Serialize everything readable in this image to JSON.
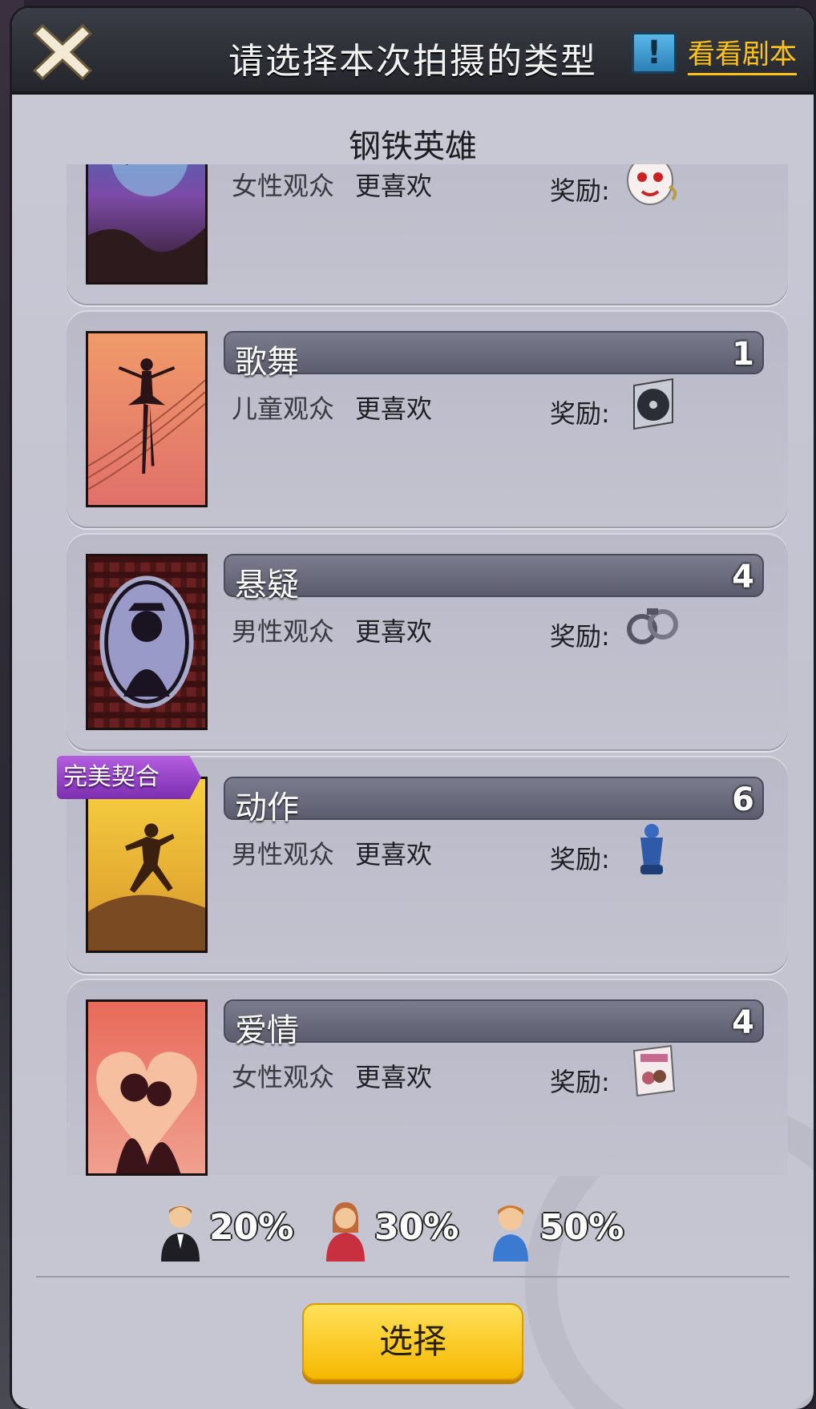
{
  "header": {
    "title": "请选择本次拍摄的类型",
    "script_label": "看看剧本",
    "script_icon": "!"
  },
  "subtitle": "钢铁英雄",
  "genres": [
    {
      "name": "",
      "count": "",
      "audience": "女性观众",
      "prefer": "更喜欢",
      "reward_label": "奖励:",
      "reward_icon": "mask-icon"
    },
    {
      "name": "歌舞",
      "count": "1",
      "audience": "儿童观众",
      "prefer": "更喜欢",
      "reward_label": "奖励:",
      "reward_icon": "disc-icon"
    },
    {
      "name": "悬疑",
      "count": "4",
      "audience": "男性观众",
      "prefer": "更喜欢",
      "reward_label": "奖励:",
      "reward_icon": "handcuffs-icon"
    },
    {
      "name": "动作",
      "count": "6",
      "audience": "男性观众",
      "prefer": "更喜欢",
      "reward_label": "奖励:",
      "reward_icon": "punching-bag-icon",
      "badge": "完美契合"
    },
    {
      "name": "爱情",
      "count": "4",
      "audience": "女性观众",
      "prefer": "更喜欢",
      "reward_label": "奖励:",
      "reward_icon": "love-magazine-icon"
    }
  ],
  "stats": {
    "male": "20%",
    "female": "30%",
    "child": "50%"
  },
  "select_label": "选择"
}
